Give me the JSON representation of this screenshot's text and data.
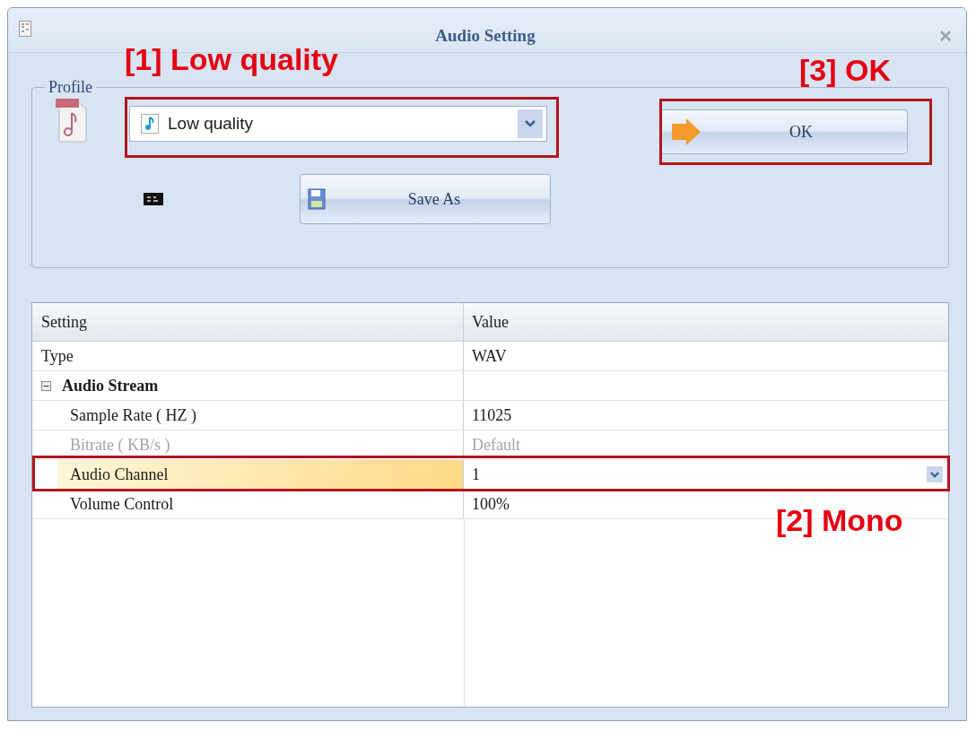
{
  "window": {
    "title": "Audio Setting"
  },
  "profile": {
    "label": "Profile",
    "preset": "Low quality",
    "save_button": "Save As",
    "ok_button": "OK"
  },
  "annotations": [
    {
      "label": "[1] Low quality"
    },
    {
      "label": "[2] Mono"
    },
    {
      "label": "[3] OK"
    }
  ],
  "table": {
    "columns": [
      "Setting",
      "Value"
    ],
    "rows": [
      {
        "kind": "row",
        "setting": "Type",
        "value": "WAV",
        "disabled": false,
        "selected": false
      },
      {
        "kind": "group",
        "setting": "Audio Stream",
        "expanded": true,
        "children": [
          {
            "setting": "Sample Rate ( HZ )",
            "value": "11025",
            "disabled": false,
            "selected": false
          },
          {
            "setting": "Bitrate ( KB/s )",
            "value": "Default",
            "disabled": true,
            "selected": false
          },
          {
            "setting": "Audio Channel",
            "value": "1",
            "disabled": false,
            "selected": true
          },
          {
            "setting": "Volume Control",
            "value": "100%",
            "disabled": false,
            "selected": false
          }
        ]
      }
    ]
  }
}
